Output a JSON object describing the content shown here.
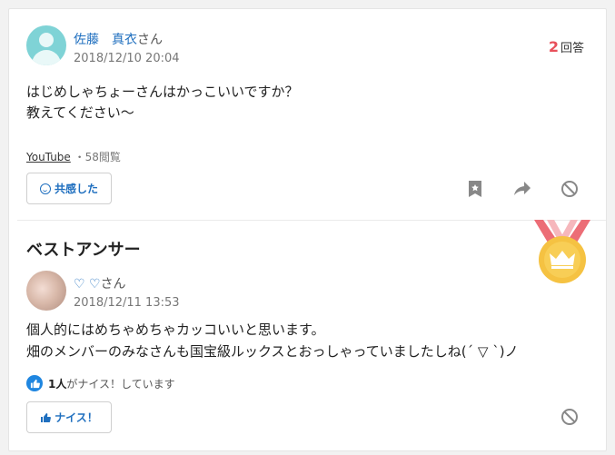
{
  "question": {
    "user_name": "佐藤　真衣",
    "user_suffix": "さん",
    "date": "2018/12/10 20:04",
    "answer_count": "2",
    "answer_label": "回答",
    "text_line1": "はじめしゃちょーさんはかっこいいですか？",
    "text_line2": "教えてください〜",
    "category": "YouTube",
    "views": "・58閲覧",
    "empathy_label": "共感した"
  },
  "best_answer": {
    "title": "ベストアンサー",
    "user_name": "♡ ♡",
    "user_suffix": "さん",
    "date": "2018/12/11 13:53",
    "text_line1": "個人的にはめちゃめちゃカッコいいと思います。",
    "text_line2": "畑のメンバーのみなさんも国宝級ルックスとおっしゃっていましたしね(ˊ ▽ ˋ)ノ",
    "nice_count": "1人",
    "nice_suffix": "がナイス！しています",
    "nice_label": "ナイス！"
  },
  "colors": {
    "accent": "#1f6fbf",
    "answer_count": "#e8505b",
    "medal_gold": "#f5c242",
    "medal_ribbon": "#ec6d76"
  }
}
